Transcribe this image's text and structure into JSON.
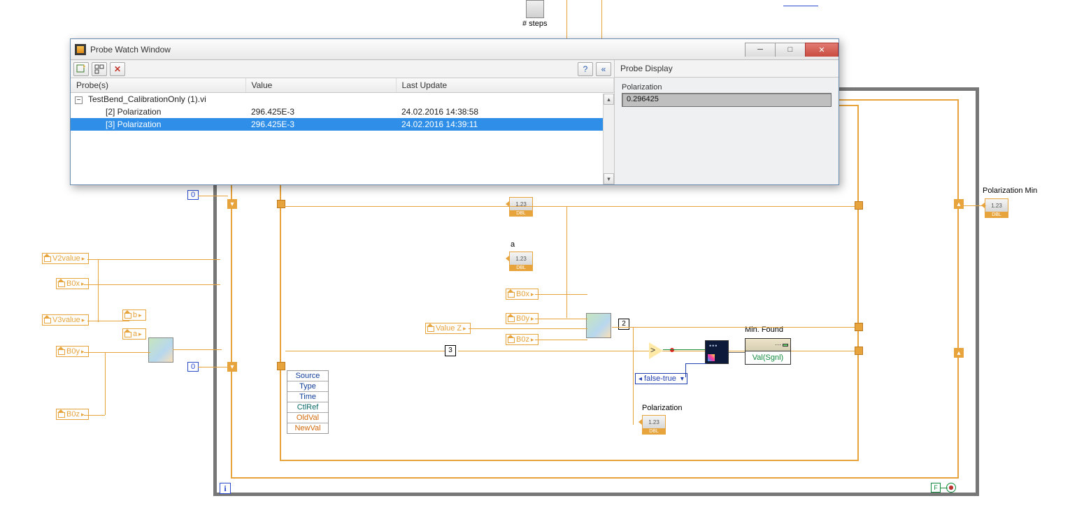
{
  "window": {
    "title": "Probe Watch Window",
    "toolbar": {
      "new_probe_tip": "New probe",
      "arrange_tip": "Arrange",
      "delete_tip": "Delete",
      "help_tip": "Help",
      "collapse_tip": "Collapse panel"
    },
    "columns": {
      "c1": "Probe(s)",
      "c2": "Value",
      "c3": "Last Update"
    },
    "group": "TestBend_CalibrationOnly (1).vi",
    "rows": [
      {
        "name": "[2] Polarization",
        "value": "296.425E-3",
        "updated": "24.02.2016 14:38:58"
      },
      {
        "name": "[3] Polarization",
        "value": "296.425E-3",
        "updated": "24.02.2016 14:39:11"
      }
    ],
    "display": {
      "header": "Probe Display",
      "label": "Polarization",
      "value": "0.296425"
    }
  },
  "diagram": {
    "steps_label": "# steps",
    "labels": {
      "a": "a",
      "polmin": "Polarization Min",
      "minfound": "Min. Found",
      "pol": "Polarization"
    },
    "locals": {
      "v2": "V2value",
      "b0x": "B0x",
      "v3": "V3value",
      "b0y": "B0y",
      "b0z": "B0z",
      "b": "b",
      "a": "a",
      "valueZ": "Value Z",
      "b0x2": "B0x",
      "b0y2": "B0y",
      "b0z2": "B0z"
    },
    "unbundle": {
      "source": "Source",
      "type": "Type",
      "time": "Time",
      "ctlref": "CtlRef",
      "oldval": "OldVal",
      "newval": "NewVal"
    },
    "probe2": "2",
    "probe3": "3",
    "ring_ft": "false-true",
    "prop_val": "Val(Sgnl)",
    "iter": "i",
    "fconst": "F",
    "zero1": "0",
    "zero2": "0",
    "dbl": "1.23",
    "dblfoot": "DBL"
  }
}
